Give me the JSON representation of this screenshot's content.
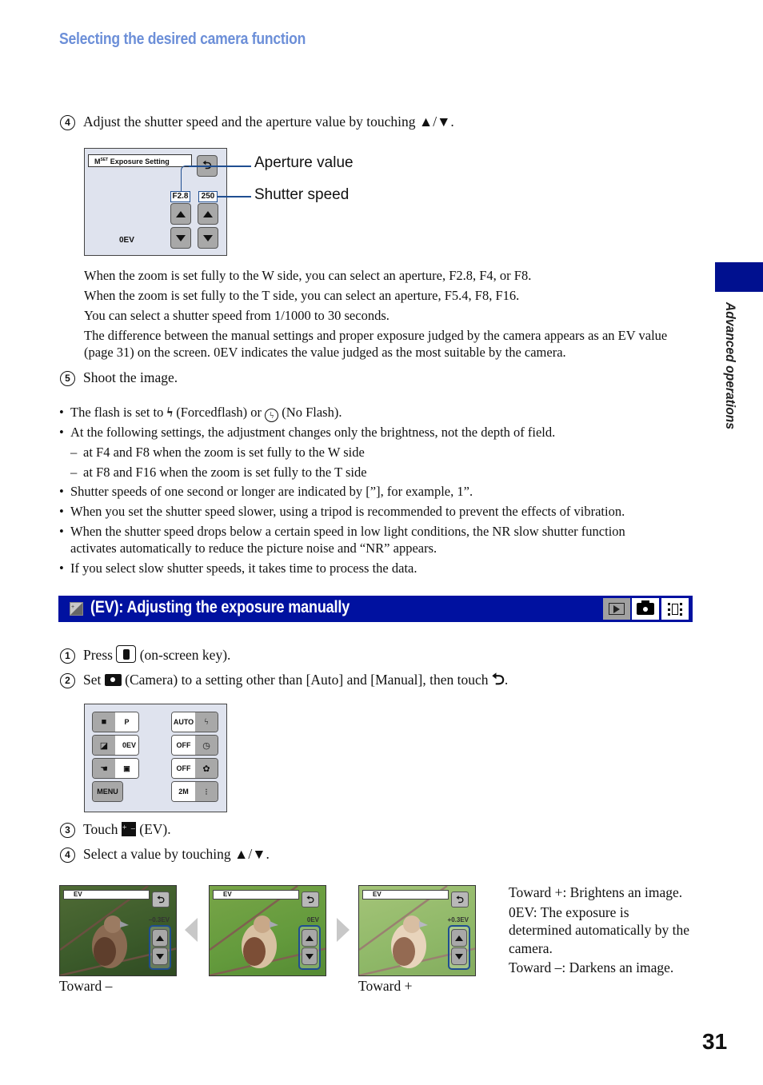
{
  "header": {
    "title": "Selecting the desired camera function"
  },
  "side_tab": {
    "label": "Advanced operations",
    "color": "#00108f"
  },
  "section1": {
    "step4": {
      "num": "4",
      "text": "Adjust the shutter speed and the aperture value by touching ▲/▼."
    },
    "screen": {
      "title_prefix": "M",
      "title_sup": "SET",
      "title": "Exposure Setting",
      "aperture": "F2.8",
      "shutter": "250",
      "ev": "0EV",
      "return_icon": "return-icon"
    },
    "callouts": {
      "aperture": "Aperture value",
      "shutter": "Shutter speed"
    },
    "notes": [
      "When the zoom is set fully to the W side, you can select an aperture, F2.8, F4, or F8.",
      "When the zoom is set fully to the T side, you can select an aperture, F5.4, F8, F16.",
      "You can select a shutter speed from 1/1000 to 30 seconds.",
      "The difference between the manual settings and proper exposure judged by the camera appears as an EV value (page 31) on the screen. 0EV indicates the value judged as the most suitable by the camera."
    ],
    "step5": {
      "num": "5",
      "text": "Shoot the image."
    }
  },
  "bullets": {
    "flash_pre": "The flash is set to",
    "flash_mid": "(Forcedflash) or",
    "flash_post": "(No Flash).",
    "b2": "At the following settings, the adjustment changes only the brightness, not the depth of field.",
    "d1": "at F4 and F8 when the zoom is set fully to the W side",
    "d2": "at F8 and F16 when the zoom is set fully to the T side",
    "b3": "Shutter speeds of one second or longer are indicated by [”], for example, 1”.",
    "b4": "When you set the shutter speed slower, using a tripod is recommended to prevent the effects of vibration.",
    "b5a": "When the shutter speed drops below a certain speed in low light conditions, the NR slow shutter function",
    "b5b": "activates automatically to reduce the picture noise and “NR” appears.",
    "b6": "If you select slow shutter speeds, it takes time to process the data.",
    "bullet_char": "•",
    "dash_char": "–"
  },
  "section_bar": {
    "title": "(EV): Adjusting the exposure manually",
    "color": "#0011a0",
    "modes": [
      {
        "name": "playback",
        "active": false
      },
      {
        "name": "camera",
        "active": true
      },
      {
        "name": "movie",
        "active": true
      }
    ]
  },
  "section2": {
    "step1": {
      "num": "1",
      "pre": "Press",
      "post": "(on-screen key)."
    },
    "step2": {
      "num": "2",
      "pre": "Set",
      "post": "(Camera) to a setting other than [Auto] and [Manual], then touch",
      "end": "."
    },
    "screen": {
      "rows_left": [
        {
          "icon": "camera-icon",
          "value": "P"
        },
        {
          "icon": "ev-icon",
          "value": "0EV"
        },
        {
          "icon": "focus-icon",
          "value": "▣"
        }
      ],
      "menu": "MENU",
      "rows_right": [
        {
          "value": "AUTO",
          "icon": "flash-icon"
        },
        {
          "value": "OFF",
          "icon": "self-timer-icon"
        },
        {
          "value": "OFF",
          "icon": "macro-icon"
        },
        {
          "value": "2M",
          "icon": "quality-icon"
        }
      ]
    },
    "step3": {
      "num": "3",
      "pre": "Touch",
      "post": "(EV)."
    },
    "step4": {
      "num": "4",
      "text": "Select a value by touching ▲/▼."
    },
    "previews": [
      {
        "header": "EV",
        "value": "–0.3EV",
        "caption": "Toward –",
        "tone": "dark"
      },
      {
        "header": "EV",
        "value": "0EV",
        "caption": "",
        "tone": "normal"
      },
      {
        "header": "EV",
        "value": "+0.3EV",
        "caption": "Toward +",
        "tone": "bright"
      }
    ],
    "descriptions": [
      "Toward +: Brightens an image.",
      "0EV: The exposure is determined automatically by the camera.",
      "Toward –: Darkens an image."
    ]
  },
  "page_number": "31"
}
